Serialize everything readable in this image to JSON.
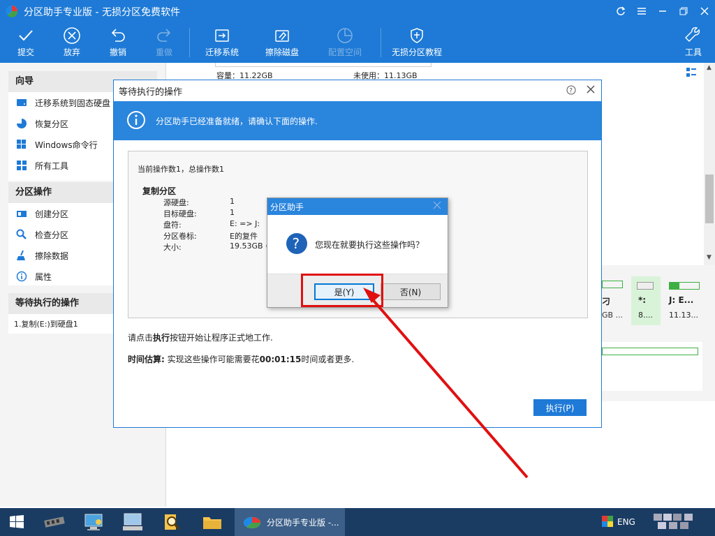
{
  "window": {
    "title": "分区助手专业版 - 无损分区免费软件"
  },
  "toolbar": {
    "commit": "提交",
    "discard": "放弃",
    "undo": "撤销",
    "redo": "重做",
    "migrate": "迁移系统",
    "wipe": "擦除磁盘",
    "allocate": "配置空间",
    "tutorial": "无损分区教程",
    "tools": "工具"
  },
  "sidebar": {
    "wizard_head": "向导",
    "wizard_items": [
      "迁移系统到固态硬盘",
      "恢复分区",
      "Windows命令行",
      "所有工具"
    ],
    "ops_head": "分区操作",
    "ops_items": [
      "创建分区",
      "检查分区",
      "擦除数据",
      "属性"
    ],
    "pending_head": "等待执行的操作",
    "pending_items": [
      "1.复制(E:)到硬盘1"
    ]
  },
  "disk_strip": {
    "capacity": "容量：11.22GB",
    "unused": "未使用：11.13GB"
  },
  "partition_panel": {
    "p1_name": "刁",
    "p1_size": "GB ...",
    "p2_name": "*:",
    "p2_size": "8....",
    "p3_name": "J: E...",
    "p3_size": "11.13..."
  },
  "dialog": {
    "title": "等待执行的操作",
    "banner": "分区助手已经准备就绪，请确认下面的操作.",
    "op_count": "当前操作数1，总操作数1",
    "op_name": "复制分区",
    "fields": [
      {
        "k": "源硬盘:",
        "v": "1"
      },
      {
        "k": "目标硬盘:",
        "v": "1"
      },
      {
        "k": "盘符:",
        "v": "E:  => J:"
      },
      {
        "k": "分区卷标:",
        "v": "E的复件"
      },
      {
        "k": "大小:",
        "v": "19.53GB ="
      }
    ],
    "hint_prefix": "请点击",
    "hint_bold": "执行",
    "hint_suffix": "按钮开始让程序正式地工作.",
    "time_label": "时间估算:",
    "time_pre": " 实现这些操作可能需要花",
    "time_value": "00:01:15",
    "time_post": "时间或者更多.",
    "execute": "执行(P)"
  },
  "confirm": {
    "title": "分区助手",
    "message": "您现在就要执行这些操作吗？",
    "yes": "是(Y)",
    "no": "否(N)"
  },
  "taskbar": {
    "active_label": "分区助手专业版 -...",
    "lang": "ENG"
  },
  "colors": {
    "accent": "#1e7ad6",
    "highlight": "#e01010"
  }
}
